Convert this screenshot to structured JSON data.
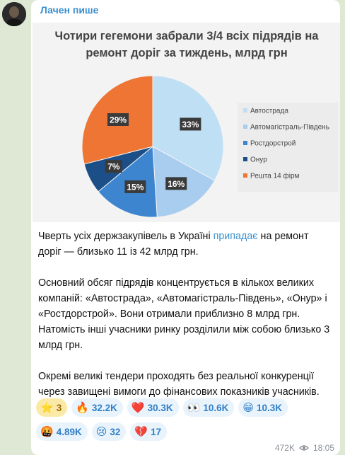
{
  "post": {
    "sender": "Лачен пише",
    "paragraphs": {
      "p1_before": "Чверть усіх держзакупівель в Україні ",
      "p1_link": "припадає",
      "p1_after": " на ремонт доріг — близько 11 із 42 млрд грн.",
      "p2": "Основний обсяг підрядів концентрується в кількох великих компаній: «Автострада», «Автомагістраль-Південь», «Онур» і «Ростдорстрой». Вони отримали приблизно 8 млрд грн. Натомість інші учасники ринку розділили між собою близько 3 млрд грн.",
      "p3": "Окремі великі тендери проходять без реальної конкуренції через завищені вимоги до фінансових показників учасників."
    },
    "reactions": [
      {
        "emoji": "⭐",
        "count": "3"
      },
      {
        "emoji": "🔥",
        "count": "32.2K"
      },
      {
        "emoji": "❤️",
        "count": "30.3K"
      },
      {
        "emoji": "👀",
        "count": "10.6K"
      },
      {
        "emoji": "😁",
        "count": "10.3K"
      },
      {
        "emoji": "🤬",
        "count": "4.89K"
      },
      {
        "emoji": "😢",
        "count": "32"
      },
      {
        "emoji": "💔",
        "count": "17"
      }
    ],
    "views": "472K",
    "time": "18:05"
  },
  "chart_data": {
    "type": "pie",
    "title": "Чотири гегемони забрали 3/4 всіх підрядів на ремонт доріг за тиждень, млрд грн",
    "title_lines": [
      "Чотири гегемони забрали 3/4 всіх підрядів на",
      "ремонт доріг за тиждень, млрд грн"
    ],
    "legend_position": "right",
    "slices": [
      {
        "label": "Автострада",
        "value": 33,
        "display": "33%",
        "color": "#bfdff4"
      },
      {
        "label": "Автомагістраль-Південь",
        "value": 16,
        "display": "16%",
        "color": "#a9cdef"
      },
      {
        "label": "Ростдорстрой",
        "value": 15,
        "display": "15%",
        "color": "#3e85cf"
      },
      {
        "label": "Онур",
        "value": 7,
        "display": "7%",
        "color": "#1c4f87"
      },
      {
        "label": "Решта 14 фірм",
        "value": 29,
        "display": "29%",
        "color": "#ee7533"
      }
    ]
  }
}
